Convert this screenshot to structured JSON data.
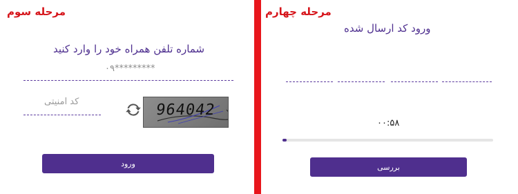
{
  "left_panel": {
    "step_title": "مرحله سوم",
    "phone_prompt": "شماره تلفن همراه خود را وارد کنید",
    "phone_value": "۰۹*********",
    "captcha_placeholder": "کد امنیتی",
    "captcha_text": "964042",
    "submit_label": "ورود"
  },
  "right_panel": {
    "step_title": "مرحله چهارم",
    "code_prompt": "ورود کد ارسال شده",
    "code_fields": [
      "",
      "",
      "",
      "",
      ""
    ],
    "timer": "۰۰:۵۸",
    "timer_progress": 0.02,
    "check_label": "بررسی"
  },
  "colors": {
    "accent": "#4f2f8e",
    "step_title": "#d6151b",
    "divider": "#e8161c"
  },
  "icons": {
    "refresh": "refresh-icon"
  }
}
